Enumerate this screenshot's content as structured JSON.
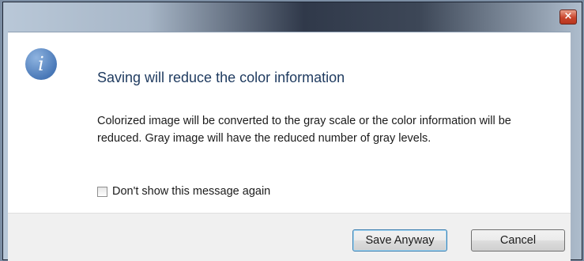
{
  "dialog": {
    "close_label": "×",
    "icon": "info-icon",
    "icon_glyph": "i",
    "heading": "Saving will reduce the color information",
    "description": "Colorized image will be converted to the gray scale or the color information will be reduced. Gray image will have the reduced number of gray levels.",
    "checkbox_label": "Don't show this message again",
    "checkbox_checked": false
  },
  "buttons": {
    "save": "Save Anyway",
    "cancel": "Cancel"
  },
  "colors": {
    "accent": "#4a79b8",
    "heading": "#1e3a5f",
    "close": "#c9452c"
  }
}
